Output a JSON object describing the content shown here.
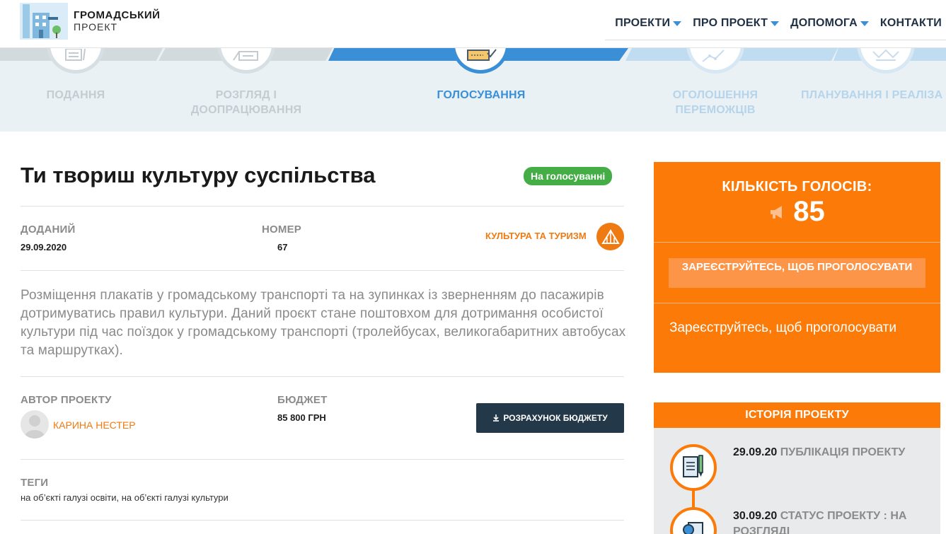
{
  "header": {
    "logo_line1": "ГРОМАДСЬКИЙ",
    "logo_line2": "ПРОЕКТ",
    "nav": [
      {
        "label": "ПРОЕКТИ",
        "has_caret": true
      },
      {
        "label": "ПРО ПРОЕКТ",
        "has_caret": true
      },
      {
        "label": "ДОПОМОГА",
        "has_caret": true
      },
      {
        "label": "КОНТАКТИ",
        "has_caret": false
      }
    ]
  },
  "stages": [
    {
      "label_line1": "ПОДАННЯ",
      "label_line2": "",
      "active": false,
      "icon": "document-pen-icon"
    },
    {
      "label_line1": "РОЗГЛЯД І",
      "label_line2": "ДООПРАЦЮВАННЯ",
      "active": false,
      "icon": "review-icon"
    },
    {
      "label_line1": "ГОЛОСУВАННЯ",
      "label_line2": "",
      "active": true,
      "icon": "ballot-icon"
    },
    {
      "label_line1": "ОГОЛОШЕННЯ",
      "label_line2": "ПЕРЕМОЖЦІВ",
      "active": false,
      "icon": "graph-icon"
    },
    {
      "label_line1": "ПЛАНУВАННЯ І РЕАЛІЗА",
      "label_line2": "",
      "active": false,
      "icon": "crown-icon"
    }
  ],
  "project": {
    "title": "Ти твориш культуру суспільства",
    "status": "На голосуванні",
    "added_label": "ДОДАНИЙ",
    "added_value": "29.09.2020",
    "number_label": "НОМЕР",
    "number_value": "67",
    "category": "КУЛЬТУРА ТА ТУРИЗМ",
    "description": "Розміщення плакатів у громадському транспорті та на зупинках із зверненням до пасажирів дотримуватись правил культури. Даний проєкт стане поштовхом для дотримання особистої культури під час поїздок у громадському транспорті (тролейбусах, великогабаритних автобусах та маршрутках).",
    "author_label": "АВТОР ПРОЕКТУ",
    "author_name": "КАРИНА НЕСТЕР",
    "budget_label": "БЮДЖЕТ",
    "budget_value": "85 800 ГРН",
    "budget_button": "РОЗРАХУНОК БЮДЖЕТУ",
    "tags_label": "ТЕГИ",
    "tags_value": "на об’єкті галузі освіти, на об’єкті галузі культури"
  },
  "votes": {
    "title": "КІЛЬКІСТЬ ГОЛОСІВ:",
    "count": "85",
    "register_button": "ЗАРЕЄСТРУЙТЕСЬ, ЩОБ ПРОГОЛОСУВАТИ",
    "register_text": "Зареєструйтесь, щоб проголосувати"
  },
  "history": {
    "title": "ІСТОРІЯ ПРОЕКТУ",
    "items": [
      {
        "date": "29.09.20",
        "text": "ПУБЛІКАЦІЯ ПРОЕКТУ"
      },
      {
        "date": "30.09.20",
        "text": "СТАТУС ПРОЕКТУ : НА РОЗГЛЯДІ"
      }
    ]
  },
  "colors": {
    "accent_orange": "#fb7a08",
    "active_blue": "#3a8fd6",
    "status_green": "#44ad46",
    "dark_button": "#233849"
  }
}
